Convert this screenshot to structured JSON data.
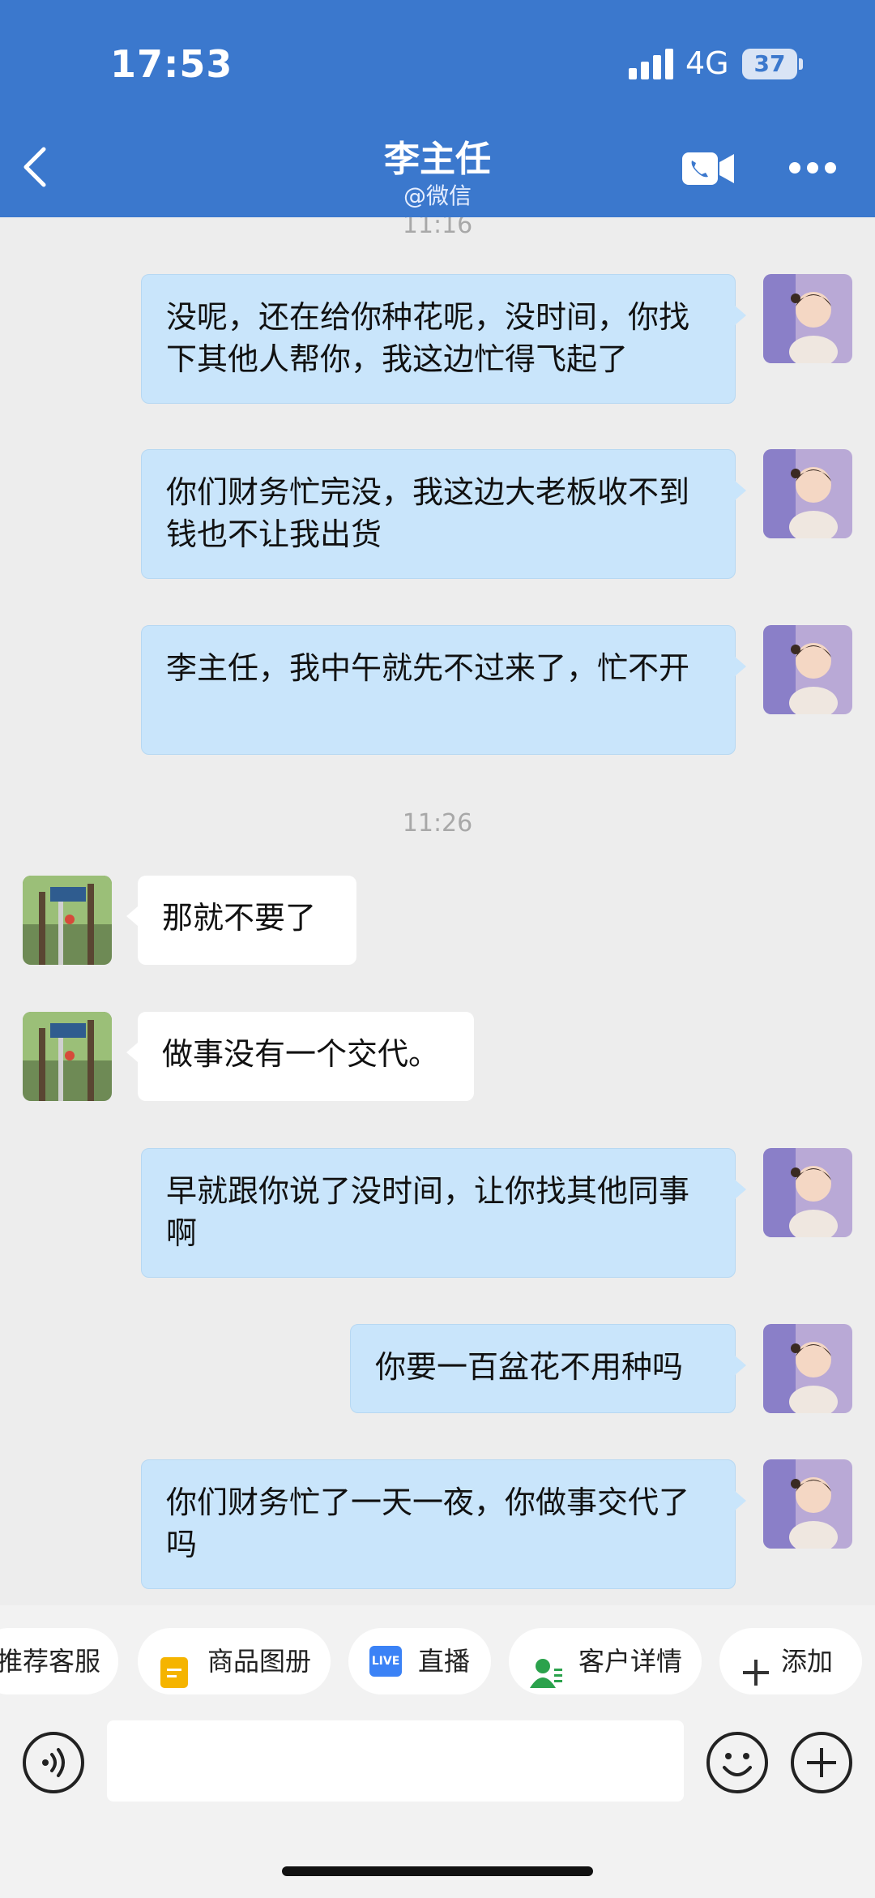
{
  "status_bar": {
    "time": "17:53",
    "network": "4G",
    "battery": "37"
  },
  "header": {
    "title": "李主任",
    "subtitle": "@微信"
  },
  "timestamps": [
    "11:16",
    "11:26"
  ],
  "messages": [
    {
      "side": "out",
      "text": "没呢，还在给你种花呢，没时间，你找下其他人帮你，我这边忙得飞起了"
    },
    {
      "side": "out",
      "text": "你们财务忙完没，我这边大老板收不到钱也不让我出货"
    },
    {
      "side": "out",
      "text": "李主任，我中午就先不过来了，忙不开"
    },
    {
      "side": "in",
      "text": "那就不要了"
    },
    {
      "side": "in",
      "text": "做事没有一个交代。"
    },
    {
      "side": "out",
      "text": "早就跟你说了没时间，让你找其他同事啊"
    },
    {
      "side": "out",
      "text": "你要一百盆花不用种吗"
    },
    {
      "side": "out",
      "text": "你们财务忙了一天一夜，你做事交代了吗"
    }
  ],
  "quick_actions": [
    {
      "label": "推荐客服",
      "icon": "none"
    },
    {
      "label": "商品图册",
      "icon": "catalog-icon"
    },
    {
      "label": "直播",
      "icon": "live-icon",
      "icon_text": "LIVE"
    },
    {
      "label": "客户详情",
      "icon": "customer-icon"
    },
    {
      "label": "添加",
      "icon": "plus-icon"
    }
  ],
  "input": {
    "placeholder": ""
  },
  "colors": {
    "header": "#3b78cd",
    "bubble_out": "#c9e5fb",
    "bubble_in": "#ffffff",
    "background": "#ededed"
  }
}
